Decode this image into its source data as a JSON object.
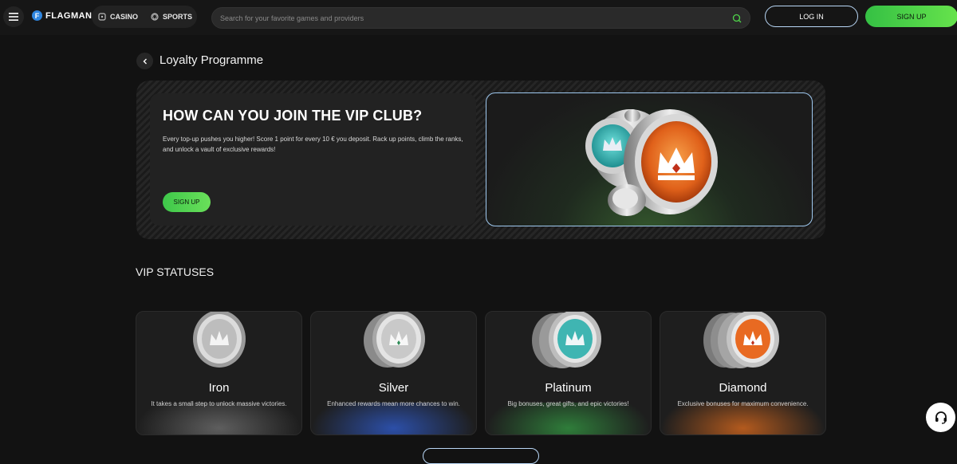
{
  "header": {
    "logo_letter": "F",
    "logo_text": "FLAGMAN",
    "nav": [
      {
        "label": "CASINO",
        "icon": "casino-icon"
      },
      {
        "label": "SPORTS",
        "icon": "sports-ball-icon"
      }
    ],
    "search_placeholder": "Search for your favorite games and providers",
    "login_label": "LOG IN",
    "signup_label": "SIGN UP"
  },
  "page": {
    "title": "Loyalty Programme"
  },
  "hero": {
    "title": "HOW CAN YOU JOIN THE VIP CLUB?",
    "description": "Every top-up pushes you higher! Score 1 point for every 10 € you deposit. Rack up points, climb the ranks, and unlock a vault of exclusive rewards!",
    "button_label": "SIGN UP"
  },
  "vip": {
    "heading": "VIP STATUSES",
    "statuses": [
      {
        "name": "Iron",
        "description": "It takes a small step to unlock massive victories.",
        "glow": "#6a6a6a"
      },
      {
        "name": "Silver",
        "description": "Enhanced rewards mean more chances to win.",
        "glow": "#2c4fa8"
      },
      {
        "name": "Platinum",
        "description": "Big bonuses, great gifts, and epic victories!",
        "glow": "#2f7d3a"
      },
      {
        "name": "Diamond",
        "description": "Exclusive bonuses for maximum convenience.",
        "glow": "#b35a1e"
      }
    ]
  },
  "colors": {
    "accent_green": "#4fd44a",
    "login_border": "#b9d7f6",
    "background": "#121212"
  }
}
